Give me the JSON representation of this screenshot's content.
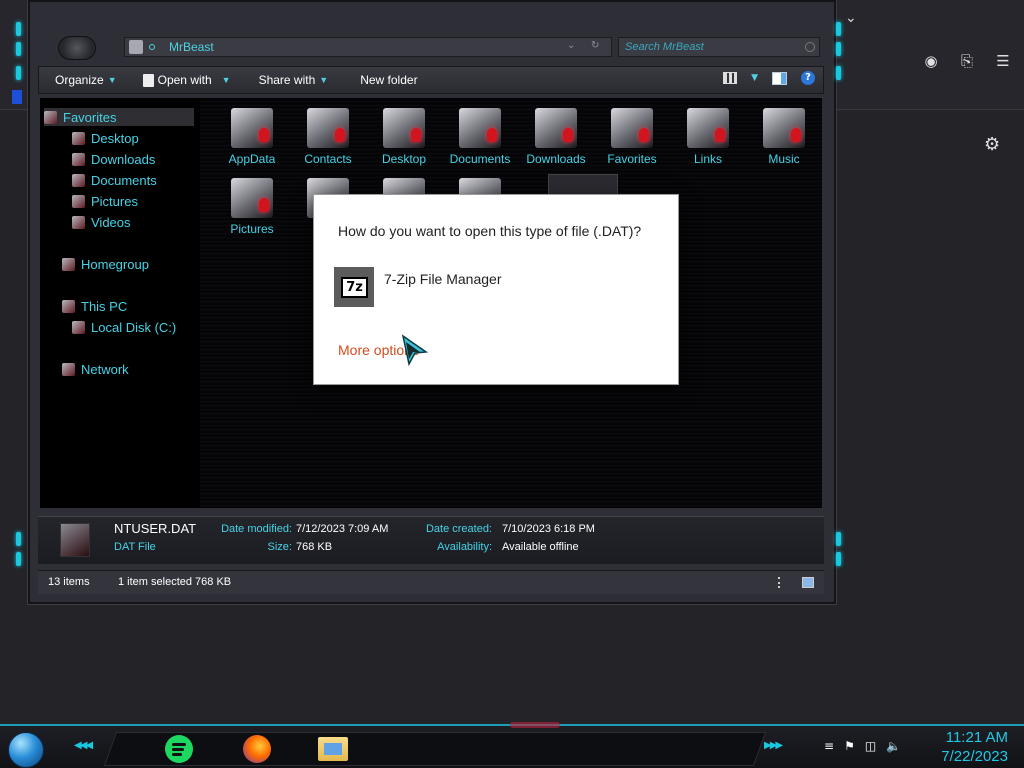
{
  "window": {
    "address": "MrBeast",
    "search_placeholder": "Search MrBeast"
  },
  "toolbar": {
    "organize": "Organize",
    "open_with": "Open with",
    "share_with": "Share with",
    "new_folder": "New folder"
  },
  "nav": {
    "favorites": "Favorites",
    "desktop": "Desktop",
    "downloads": "Downloads",
    "documents": "Documents",
    "pictures": "Pictures",
    "videos": "Videos",
    "homegroup": "Homegroup",
    "this_pc": "This PC",
    "local_disk": "Local Disk (C:)",
    "network": "Network"
  },
  "files": [
    {
      "label": "AppData"
    },
    {
      "label": "Contacts"
    },
    {
      "label": "Desktop"
    },
    {
      "label": "Documents"
    },
    {
      "label": "Downloads"
    },
    {
      "label": "Favorites"
    },
    {
      "label": "Links"
    },
    {
      "label": "Music"
    },
    {
      "label": "Pictures"
    }
  ],
  "details": {
    "name": "NTUSER.DAT",
    "type": "DAT File",
    "date_modified_label": "Date modified:",
    "date_modified": "7/12/2023 7:09 AM",
    "size_label": "Size:",
    "size": "768 KB",
    "date_created_label": "Date created:",
    "date_created": "7/10/2023 6:18 PM",
    "availability_label": "Availability:",
    "availability": "Available offline"
  },
  "status": {
    "count": "13 items",
    "selected": "1 item selected  768 KB"
  },
  "dialog": {
    "question": "How do you want to open this type of file (.DAT)?",
    "app_icon_text": "7z",
    "app_name": "7-Zip File Manager",
    "more_options": "More options"
  },
  "taskbar": {
    "time": "11:21 AM",
    "date": "7/22/2023"
  },
  "colors": {
    "accent_cyan": "#45d3e6",
    "link_orange": "#d34b1f",
    "dialog_bg": "#ffffff"
  }
}
